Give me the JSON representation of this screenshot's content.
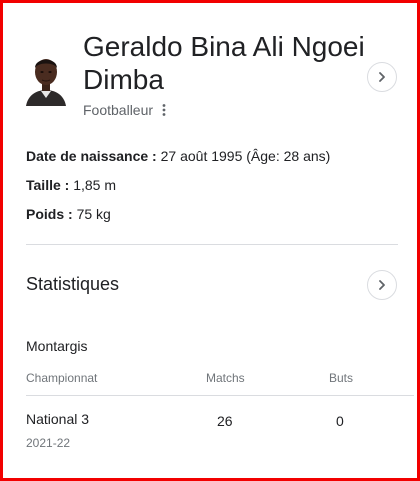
{
  "profile": {
    "name": "Geraldo Bina Ali Ngoei Dimba",
    "subtitle": "Footballeur",
    "more_icon": "kebab-menu-icon",
    "expand_icon": "chevron-right-icon"
  },
  "facts": [
    {
      "label": "Date de naissance :",
      "value": "27 août 1995 (Âge: 28 ans)"
    },
    {
      "label": "Taille :",
      "value": "1,85 m"
    },
    {
      "label": "Poids :",
      "value": "75 kg"
    }
  ],
  "stats": {
    "title": "Statistiques",
    "team": "Montargis",
    "columns": [
      "Championnat",
      "Matchs",
      "Buts"
    ],
    "rows": [
      {
        "competition": "National 3",
        "season": "2021-22",
        "matches": "26",
        "goals": "0"
      }
    ]
  },
  "colors": {
    "frame": "#f20000",
    "divider": "#dadce0",
    "secondary_text": "#70757a"
  }
}
